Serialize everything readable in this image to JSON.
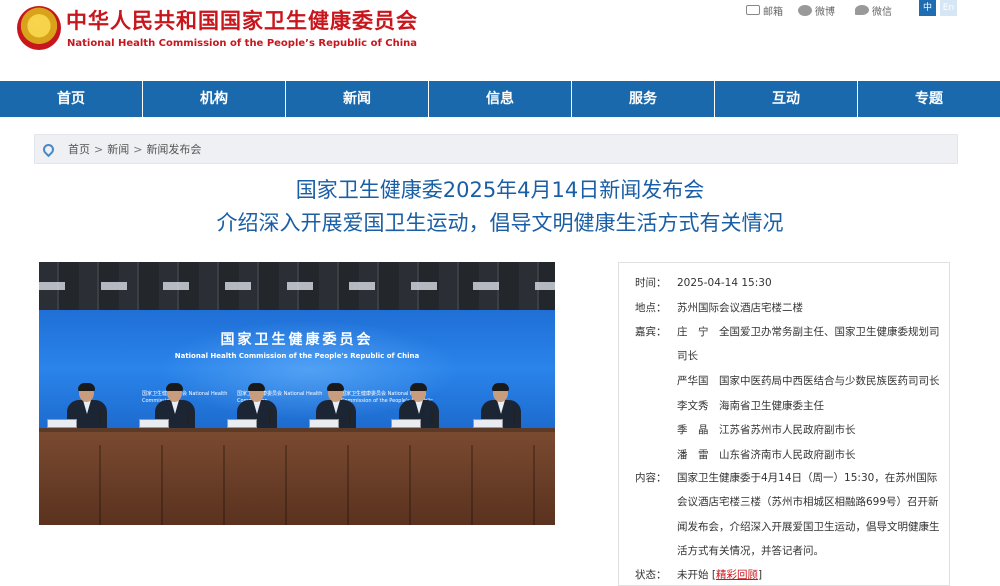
{
  "header": {
    "title": "中华人民共和国国家卫生健康委员会",
    "subtitle": "National Health Commission of the People’s Republic of China",
    "share": {
      "mail": "邮箱",
      "weibo": "微博",
      "wechat": "微信"
    },
    "lang": {
      "zh": "中",
      "en": "En"
    },
    "emblem_star": "★"
  },
  "nav": [
    "首页",
    "机构",
    "新闻",
    "信息",
    "服务",
    "互动",
    "专题"
  ],
  "breadcrumb": {
    "home": "首页",
    "news": "新闻",
    "current": "新闻发布会",
    "sep": ">"
  },
  "article": {
    "title_line1": "国家卫生健康委2025年4月14日新闻发布会",
    "title_line2": "介绍深入开展爱国卫生运动，倡导文明健康生活方式有关情况"
  },
  "photo": {
    "screen_title": "国家卫生健康委员会",
    "screen_subtitle": "National Health Commission of the People's Republic of China",
    "name_strips": [
      "国家卫生健康委员会 National Health",
      "Commission",
      "国家卫生健康委员会 National Health",
      "Commission",
      "国家卫生健康委员会 National Health",
      "Commission of the People's Republic"
    ]
  },
  "info": {
    "time_label": "时间：",
    "time_value": "2025-04-14 15:30",
    "place_label": "地点：",
    "place_value": "苏州国际会议酒店宅楼二楼",
    "guests_label": "嘉宾：",
    "guest1_line1": "庄　宁　全国爱卫办常务副主任、国家卫生健康委规划司",
    "guest1_line2": "司长",
    "guest2": "严华国　国家中医药局中西医结合与少数民族医药司司长",
    "guest3": "李文秀　海南省卫生健康委主任",
    "guest4": "季　晶　江苏省苏州市人民政府副市长",
    "guest5": "潘　雷　山东省济南市人民政府副市长",
    "content_label": "内容：",
    "content_line1": "国家卫生健康委于4月14日（周一）15:30，在苏州国际",
    "content_line2": "会议酒店宅楼三楼（苏州市相城区相融路699号）召开新",
    "content_line3": "闻发布会，介绍深入开展爱国卫生运动，倡导文明健康生",
    "content_line4": "活方式有关情况，并答记者问。",
    "status_label": "状态：",
    "status_value": "未开始",
    "review_open": "[",
    "review_label": "精彩回顾",
    "review_close": "]"
  }
}
